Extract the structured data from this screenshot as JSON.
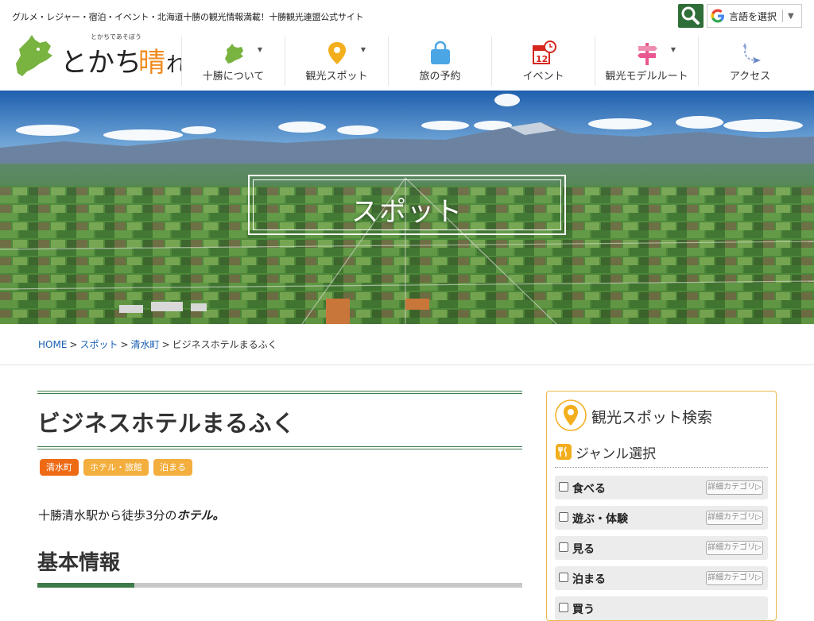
{
  "header": {
    "tagline": "グルメ・レジャー・宿泊・イベント・北海道十勝の観光情報満載！十勝観光連盟公式サイト",
    "search_icon": "search-icon",
    "translate_label": "言語を選択",
    "translate_arrow": "▼",
    "logo_sub": "とかちであそぼう",
    "logo_main_1": "とかち",
    "logo_main_2": "晴",
    "logo_main_3": "れ"
  },
  "nav": [
    {
      "label": "十勝について",
      "icon": "hokkaido-map-icon",
      "caret": "▼"
    },
    {
      "label": "観光スポット",
      "icon": "map-pin-icon",
      "caret": "▼"
    },
    {
      "label": "旅の予約",
      "icon": "shopping-bag-icon",
      "caret": ""
    },
    {
      "label": "イベント",
      "icon": "calendar-icon",
      "caret": ""
    },
    {
      "label": "観光モデルルート",
      "icon": "signpost-icon",
      "caret": "▼"
    },
    {
      "label": "アクセス",
      "icon": "plane-icon",
      "caret": ""
    }
  ],
  "hero": {
    "title": "スポット"
  },
  "breadcrumb": {
    "items": [
      "HOME",
      "スポット",
      "清水町"
    ],
    "current": "ビジネスホテルまるふく",
    "separator": ">"
  },
  "main": {
    "title": "ビジネスホテルまるふく",
    "tags": [
      {
        "label": "清水町",
        "color": "#ee6a14"
      },
      {
        "label": "ホテル・旅館",
        "color": "#f3ae3d"
      },
      {
        "label": "泊まる",
        "color": "#f3ae3d"
      }
    ],
    "description_prefix": "十勝清水駅から徒歩3分の",
    "description_emphasis": "ホテル。",
    "section_title": "基本情報"
  },
  "sidebar": {
    "title": "観光スポット検索",
    "genre_title": "ジャンル選択",
    "detail_label": "詳細カテゴリ▷",
    "genres": [
      "食べる",
      "遊ぶ・体験",
      "見る",
      "泊まる",
      "買う"
    ]
  },
  "colors": {
    "accent_green": "#3d7a4a",
    "orange": "#ee6a14",
    "light_orange": "#f3ae3d",
    "sidebar_border": "#e8b84a"
  }
}
